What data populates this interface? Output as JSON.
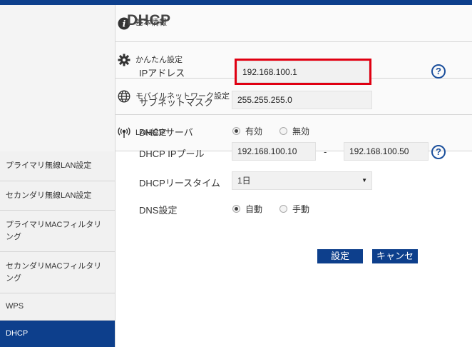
{
  "sidebar": {
    "items": [
      {
        "label": "基本情報",
        "icon": "info-icon"
      },
      {
        "label": "かんたん設定",
        "icon": "gear-icon"
      },
      {
        "label": "モバイルネットワーク設定",
        "icon": "globe-icon"
      },
      {
        "label": "LAN設定",
        "icon": "wifi-signal-icon"
      },
      {
        "label": "プライマリ無線LAN設定"
      },
      {
        "label": "セカンダリ無線LAN設定"
      },
      {
        "label": "プライマリMACフィルタリング"
      },
      {
        "label": "セカンダリMACフィルタリング"
      },
      {
        "label": "WPS"
      },
      {
        "label": "DHCP"
      }
    ],
    "active": "DHCP"
  },
  "page": {
    "title": "DHCP"
  },
  "form": {
    "ip_address": {
      "label": "IPアドレス",
      "value": "192.168.100.1"
    },
    "subnet_mask": {
      "label": "サブネットマスク",
      "value": "255.255.255.0"
    },
    "dhcp_server": {
      "label": "DHCPサーバ",
      "options": [
        "有効",
        "無効"
      ],
      "selected": "有効"
    },
    "dhcp_pool": {
      "label": "DHCP IPプール",
      "start": "192.168.100.10",
      "separator": "-",
      "end": "192.168.100.50"
    },
    "lease_time": {
      "label": "DHCPリースタイム",
      "value": "1日"
    },
    "dns": {
      "label": "DNS設定",
      "options": [
        "自動",
        "手動"
      ],
      "selected": "自動"
    },
    "help_symbol": "?"
  },
  "buttons": {
    "save": "設定",
    "cancel": "キャンセル"
  },
  "colors": {
    "brand": "#0d3f8c",
    "highlight": "#e00012"
  }
}
